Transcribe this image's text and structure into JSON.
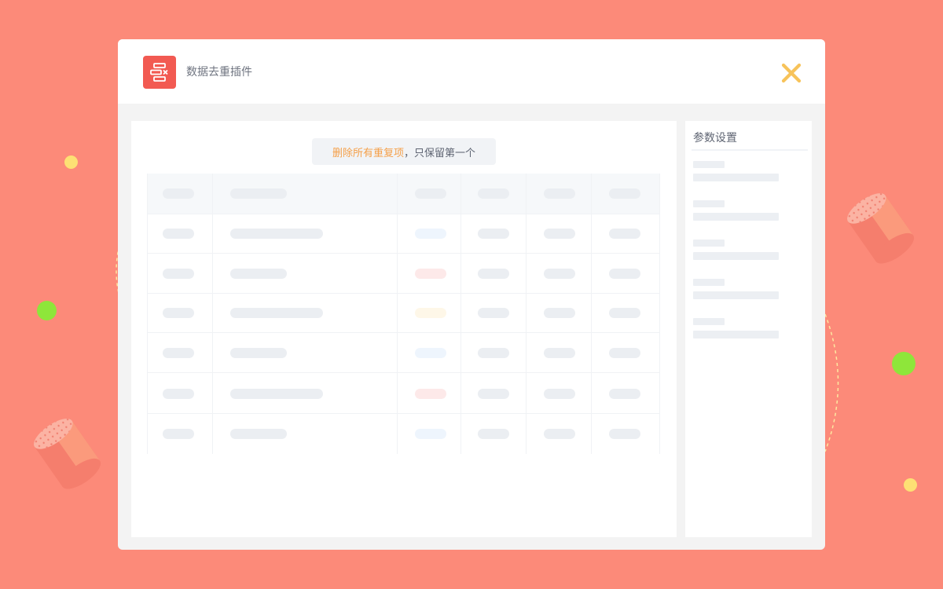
{
  "app": {
    "title": "数据去重插件",
    "icon": "dedupe-table-icon",
    "close_icon": "close-x-icon"
  },
  "banner": {
    "highlight": "删除所有重复项",
    "rest": "，只保留第一个"
  },
  "settings": {
    "title": "参数设置",
    "field_count": 5
  },
  "table": {
    "column_count": 6,
    "row_count": 6,
    "status_colors": [
      "#eef5fd",
      "#fde9e9",
      "#fef7e8",
      "#eef5fd",
      "#fde9e9",
      "#eef5fd"
    ]
  },
  "colors": {
    "background": "#fc8a79",
    "accent_red": "#f25a52",
    "highlight_orange": "#f5a04a",
    "close_yellow": "#f7c35a",
    "dot_green": "#8ee63a",
    "dot_yellow": "#fde074"
  }
}
